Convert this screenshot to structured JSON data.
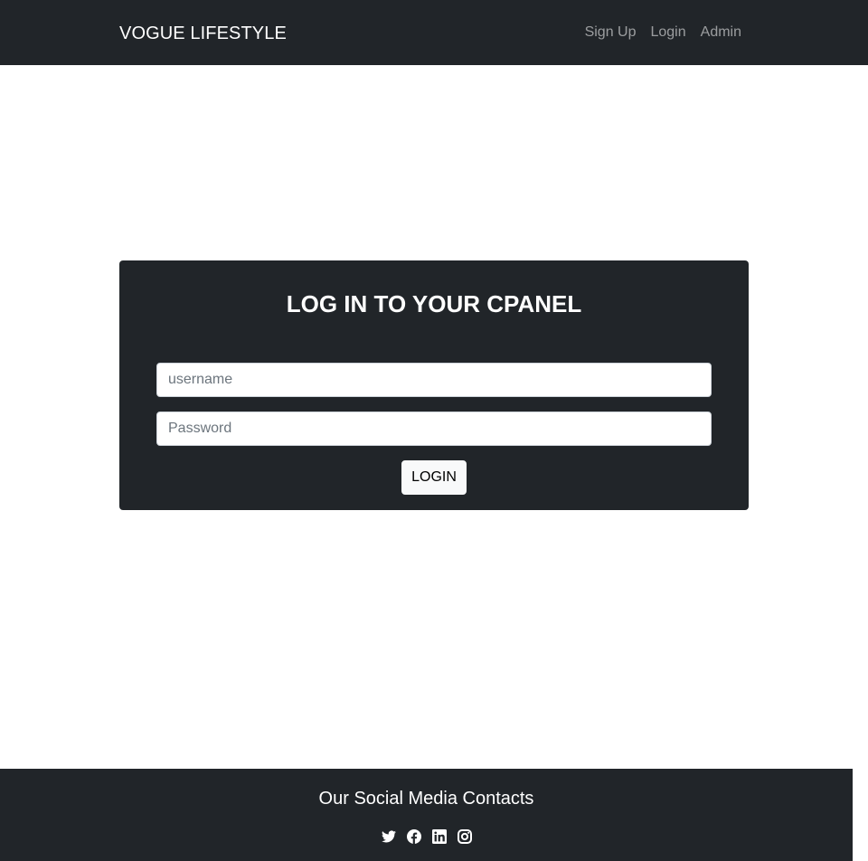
{
  "navbar": {
    "brand": "VOGUE LIFESTYLE",
    "links": [
      {
        "label": "Sign Up"
      },
      {
        "label": "Login"
      },
      {
        "label": "Admin"
      }
    ]
  },
  "login": {
    "title": "LOG IN TO YOUR CPANEL",
    "username_placeholder": "username",
    "username_value": "",
    "password_placeholder": "Password",
    "password_value": "",
    "submit_label": "LOGIN"
  },
  "footer": {
    "title": "Our Social Media Contacts",
    "icons": [
      "twitter-icon",
      "facebook-icon",
      "linkedin-icon",
      "instagram-icon"
    ]
  },
  "colors": {
    "dark": "#212529",
    "light_button": "#f8f9fa",
    "nav_link": "rgba(255,255,255,0.55)"
  }
}
